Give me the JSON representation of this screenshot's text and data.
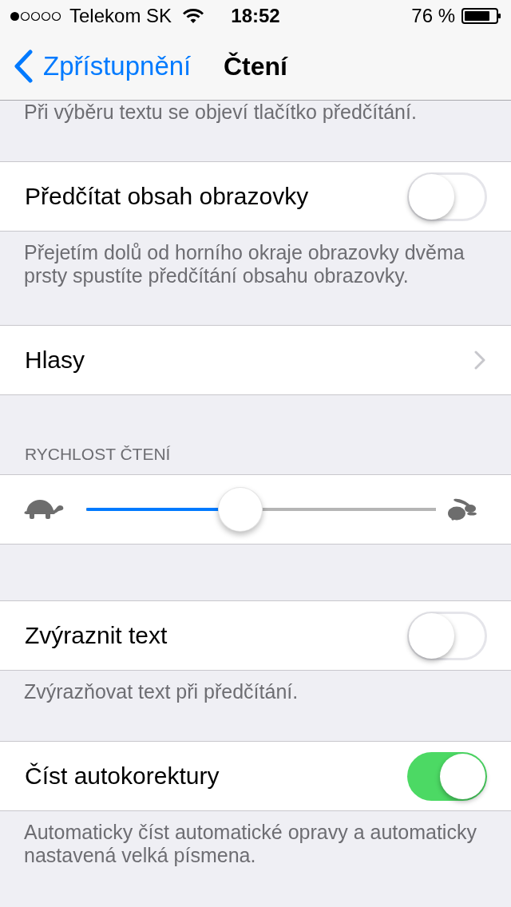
{
  "status_bar": {
    "carrier": "Telekom SK",
    "time": "18:52",
    "battery": "76 %"
  },
  "nav_bar": {
    "back": "Zpřístupnění",
    "title": "Čtení"
  },
  "sections": [
    {
      "footer": "Při výběru textu se objeví tlačítko předčítání."
    },
    {
      "rows": [
        {
          "kind": "toggle",
          "label": "Předčítat obsah obrazovky",
          "on": false
        }
      ],
      "footer": "Přejetím dolů od horního okraje obrazovky dvěma prsty spustíte předčítání obsahu obrazovky."
    },
    {
      "rows": [
        {
          "kind": "link",
          "label": "Hlasy"
        }
      ]
    },
    {
      "header": "RYCHLOST ČTENÍ",
      "rows": [
        {
          "kind": "slider",
          "level": 0.44
        }
      ]
    },
    {
      "rows": [
        {
          "kind": "toggle",
          "label": "Zvýraznit text",
          "on": false
        }
      ],
      "footer": "Zvýrazňovat text při předčítání."
    },
    {
      "rows": [
        {
          "kind": "toggle",
          "label": "Číst autokorektury",
          "on": true
        }
      ],
      "footer": "Automaticky číst automatické opravy a automaticky nastavená velká písmena."
    }
  ]
}
